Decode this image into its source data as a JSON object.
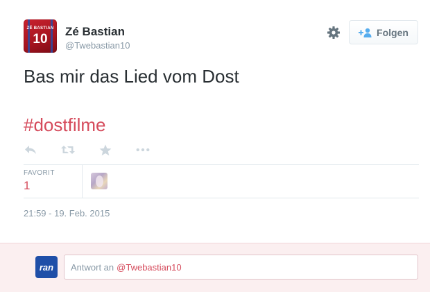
{
  "user": {
    "name": "Zé Bastian",
    "handle": "@Twebastian10",
    "avatar_text": "ZÉ BASTIAN",
    "avatar_number": "10"
  },
  "header": {
    "follow_label": "Folgen",
    "gear_icon": "gear-icon",
    "follow_icon": "add-user-icon"
  },
  "tweet": {
    "text": "Bas mir das Lied vom Dost",
    "hashtag": "#dostfilme",
    "timestamp": "21:59 - 19. Feb. 2015"
  },
  "actions": [
    "reply-icon",
    "retweet-icon",
    "favorite-icon",
    "more-icon"
  ],
  "stats": {
    "label": "FAVORIT",
    "count": "1"
  },
  "reply": {
    "logo_text": "ran",
    "prefix": "Antwort an",
    "mention": "@Twebastian10"
  },
  "colors": {
    "accent": "#d54a5b",
    "muted": "#8899a6",
    "text": "#292f33",
    "reply_bg": "#fbeff0",
    "logo_bg": "#1f4fa8"
  }
}
